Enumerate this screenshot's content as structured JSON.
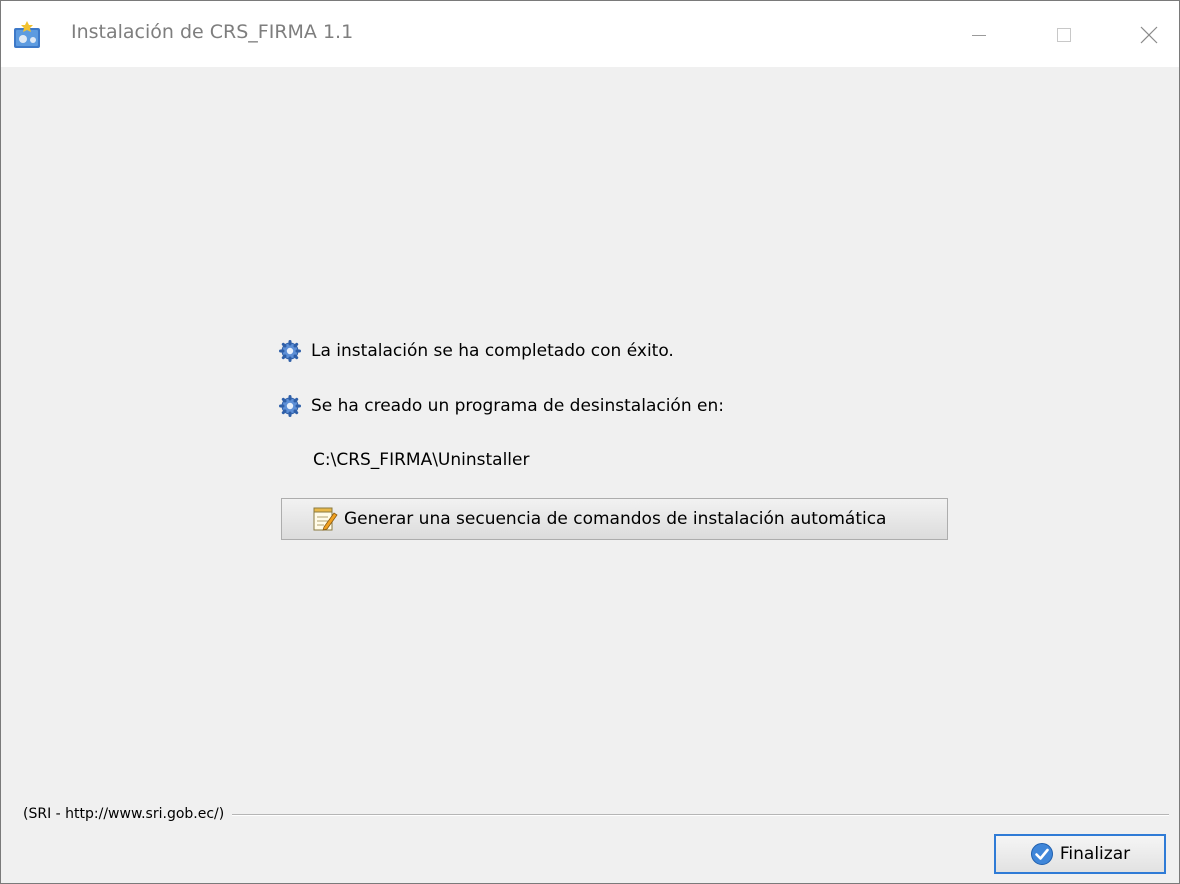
{
  "window": {
    "title": "Instalación de CRS_FIRMA 1.1",
    "app_icon": "installer-icon"
  },
  "controls": {
    "minimize_icon": "minimize-icon",
    "maximize_icon": "maximize-icon",
    "close_icon": "close-icon"
  },
  "messages": [
    {
      "icon": "gear-icon",
      "text": "La instalación se ha completado con éxito."
    },
    {
      "icon": "gear-icon",
      "text": "Se ha creado un programa de desinstalación en:"
    }
  ],
  "uninstaller_path": "C:\\CRS_FIRMA\\Uninstaller",
  "script_button": {
    "icon": "edit-notepad-icon",
    "label": "Generar una secuencia de comandos de instalación automática"
  },
  "footer": {
    "vendor_label": "(SRI - http://www.sri.gob.ec/)"
  },
  "finish_button": {
    "icon": "checkmark-circle-icon",
    "label": "Finalizar"
  },
  "colors": {
    "background": "#f0f0f0",
    "titlebar": "#ffffff",
    "title_text": "#7e7e7e",
    "focus_border": "#2f7bd6"
  }
}
